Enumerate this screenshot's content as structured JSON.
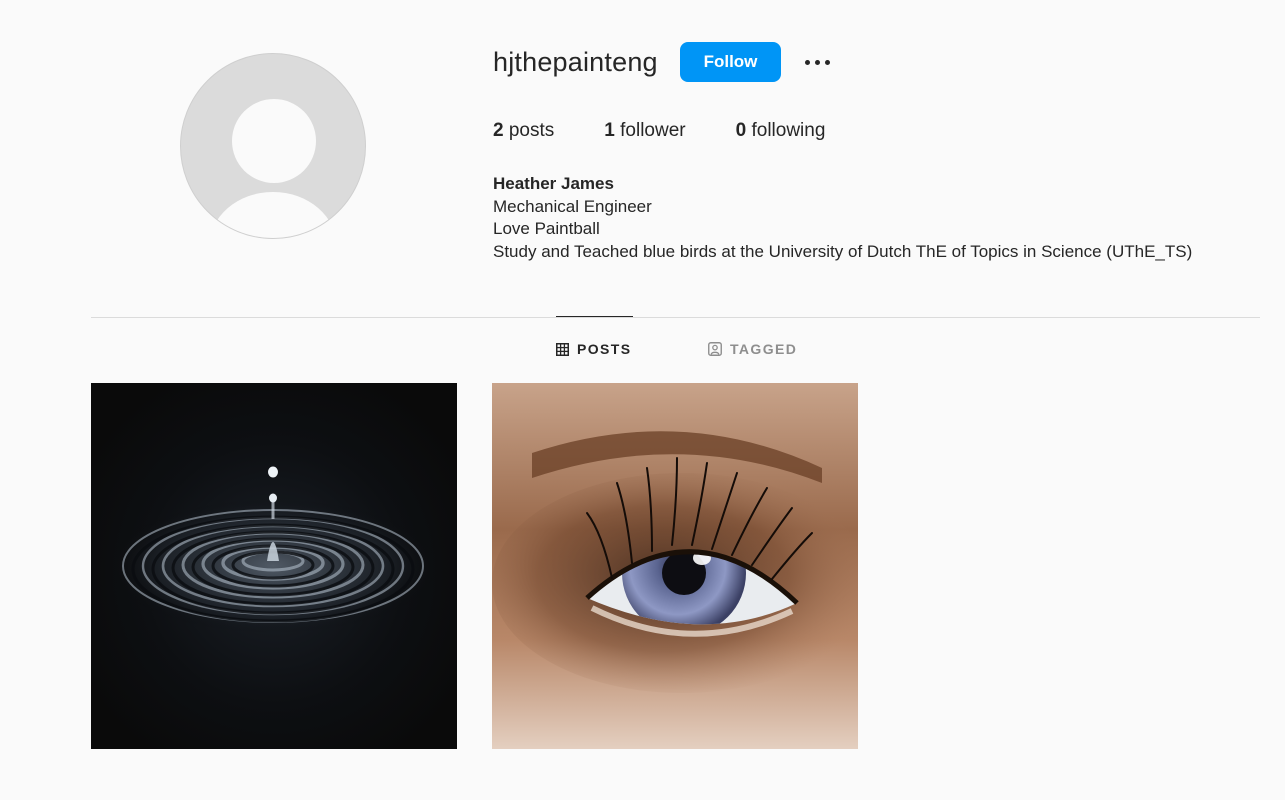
{
  "profile": {
    "username": "hjthepainteng",
    "follow_label": "Follow",
    "stats": {
      "posts_count": "2",
      "posts_label": "posts",
      "followers_count": "1",
      "followers_label": "follower",
      "following_count": "0",
      "following_label": "following"
    },
    "bio": {
      "full_name": "Heather James",
      "line1": "Mechanical Engineer",
      "line2": "Love Paintball",
      "line3": "Study and Teached blue birds at the University of Dutch ThE of Topics in Science (UThE_TS)"
    }
  },
  "tabs": [
    {
      "label": "POSTS",
      "icon": "grid-icon",
      "active": true
    },
    {
      "label": "TAGGED",
      "icon": "tagged-user-icon",
      "active": false
    }
  ],
  "posts": [
    {
      "subject": "water-drop-ripple"
    },
    {
      "subject": "blue-eye-closeup"
    }
  ],
  "colors": {
    "accent": "#0095f6",
    "background": "#fafafa",
    "text": "#262626",
    "muted": "#8e8e8e",
    "divider": "#dbdbdb"
  }
}
